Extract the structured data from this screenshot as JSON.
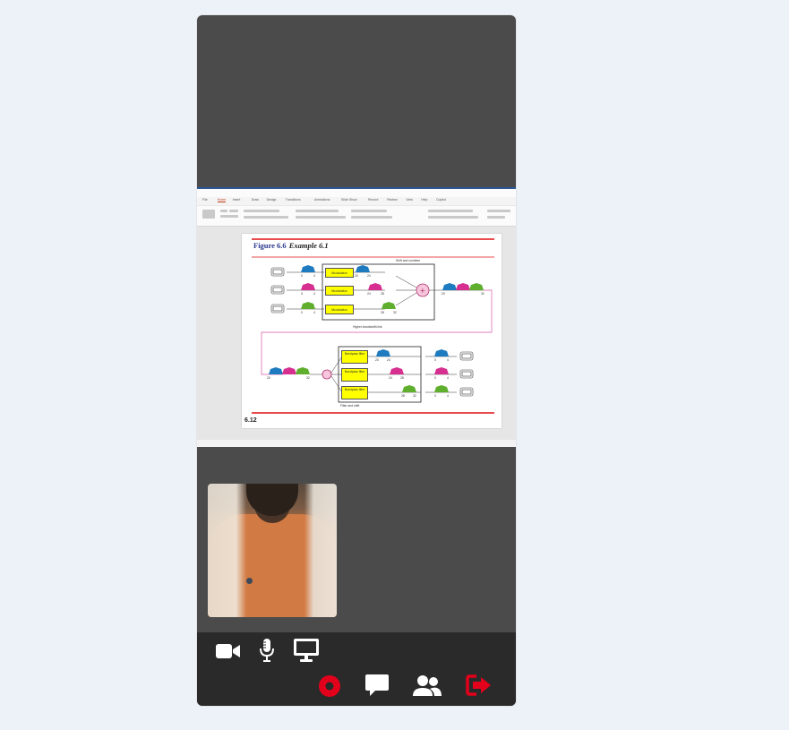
{
  "shared_screen": {
    "app_tabs": [
      "File",
      "Home",
      "Insert",
      "Draw",
      "Design",
      "Transitions",
      "Animations",
      "Slide Show",
      "Record",
      "Review",
      "View",
      "Help",
      "Copilot"
    ],
    "active_tab": "Home",
    "slide": {
      "title": "Figure 6.6",
      "subtitle": "Example 6.1",
      "slide_number": "6.12",
      "top_section_label": "Shift and combine",
      "middle_label": "Higher-bandwidth link",
      "bottom_section_label": "Filter and shift",
      "modulator_label": "Modulator",
      "bandpass_label": "Bandpass filter",
      "mod_ranges": [
        [
          "0",
          "4"
        ],
        [
          "0",
          "4"
        ],
        [
          "0",
          "4"
        ]
      ],
      "shift_ranges": [
        [
          "20",
          "24"
        ],
        [
          "24",
          "28"
        ],
        [
          "28",
          "32"
        ]
      ],
      "combined_range": [
        "20",
        "32"
      ],
      "filter_out_ranges": [
        [
          "0",
          "4"
        ],
        [
          "0",
          "4"
        ],
        [
          "0",
          "4"
        ]
      ],
      "colors": {
        "blue": "#1f7bbf",
        "pink": "#d62f8f",
        "green": "#5fae2e",
        "red_rule": "#e01010",
        "link_line": "#e07fb8",
        "box_yellow": "#ffff00"
      }
    }
  },
  "participant_video": {
    "shirt_text": ""
  },
  "controls": {
    "camera": "video-camera-icon",
    "microphone": "microphone-icon",
    "screen_share": "monitor-icon",
    "record": "record-icon",
    "chat": "chat-bubble-icon",
    "participants": "participants-icon",
    "leave": "leave-icon",
    "record_color": "#e3001b",
    "leave_color": "#e3001b"
  }
}
